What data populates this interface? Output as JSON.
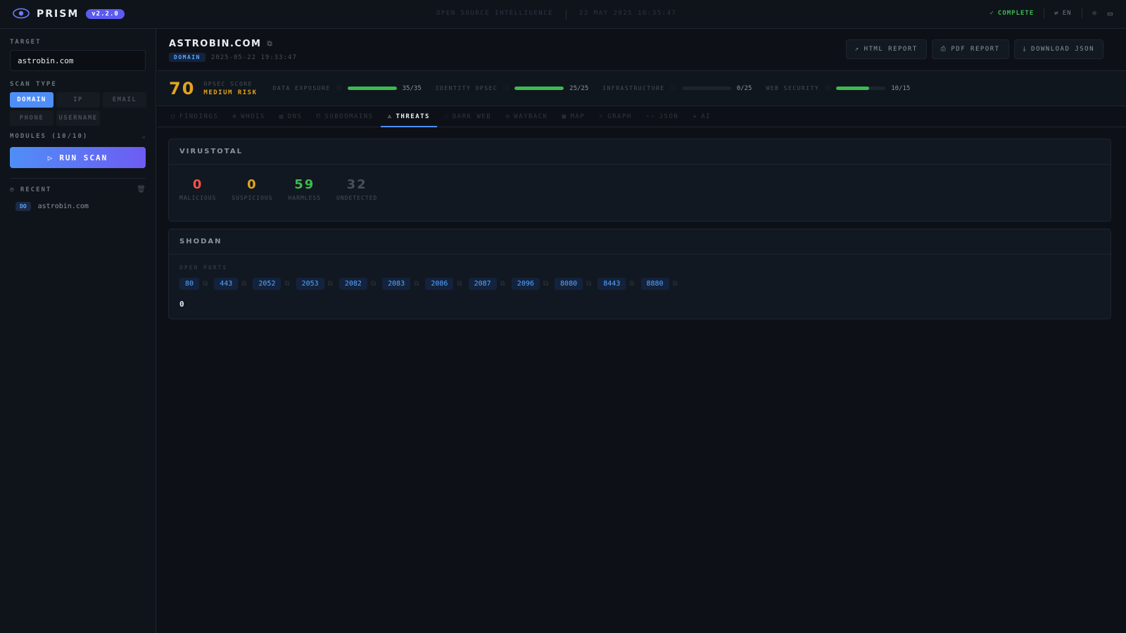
{
  "app": {
    "name": "PRISM",
    "version": "v2.2.0",
    "tagline": "OPEN SOURCE INTELLIGENCE",
    "datetime": "22 MAY 2025 16:35:47"
  },
  "top_right": {
    "status": "COMPLETE",
    "language": "EN"
  },
  "sidebar": {
    "target_label": "TARGET",
    "target_value": "astrobin.com",
    "scan_type_label": "SCAN TYPE",
    "scan_types": [
      "DOMAIN",
      "IP",
      "EMAIL",
      "PHONE",
      "USERNAME"
    ],
    "active_scan_type": "DOMAIN",
    "modules_label": "MODULES (10/10)",
    "run_label": "RUN SCAN",
    "recent_label": "RECENT",
    "recent": [
      {
        "tag": "DO",
        "text": "astrobin.com"
      }
    ]
  },
  "header": {
    "title": "ASTROBIN.COM",
    "badge": "DOMAIN",
    "timestamp": "2025-05-22 19:33:47",
    "actions": [
      "HTML REPORT",
      "PDF REPORT",
      "DOWNLOAD JSON"
    ]
  },
  "score": {
    "value": "70",
    "label": "OPSEC SCORE",
    "risk": "MEDIUM RISK",
    "metrics": [
      {
        "name": "DATA EXPOSURE",
        "value": "35/35",
        "fraction": 1.0
      },
      {
        "name": "IDENTITY OPSEC",
        "value": "25/25",
        "fraction": 1.0
      },
      {
        "name": "INFRASTRUCTURE",
        "value": "0/25",
        "fraction": 0.0
      },
      {
        "name": "WEB SECURITY",
        "value": "10/15",
        "fraction": 0.667
      }
    ]
  },
  "tabs": [
    "FINDINGS",
    "WHOIS",
    "DNS",
    "SUBDOMAINS",
    "THREATS",
    "DARK WEB",
    "WAYBACK",
    "MAP",
    "GRAPH",
    "JSON",
    "AI"
  ],
  "active_tab": "THREATS",
  "virustotal": {
    "title": "VIRUSTOTAL",
    "stats": [
      {
        "value": "0",
        "label": "MALICIOUS",
        "color": "#f85149"
      },
      {
        "value": "0",
        "label": "SUSPICIOUS",
        "color": "#e3a321"
      },
      {
        "value": "59",
        "label": "HARMLESS",
        "color": "#3fb950"
      },
      {
        "value": "32",
        "label": "UNDETECTED",
        "color": "#484f58"
      }
    ]
  },
  "shodan": {
    "title": "SHODAN",
    "ports_label": "OPEN PORTS",
    "ports": [
      "80",
      "443",
      "2052",
      "2053",
      "2082",
      "2083",
      "2086",
      "2087",
      "2096",
      "8080",
      "8443",
      "8880"
    ],
    "count": "0"
  }
}
